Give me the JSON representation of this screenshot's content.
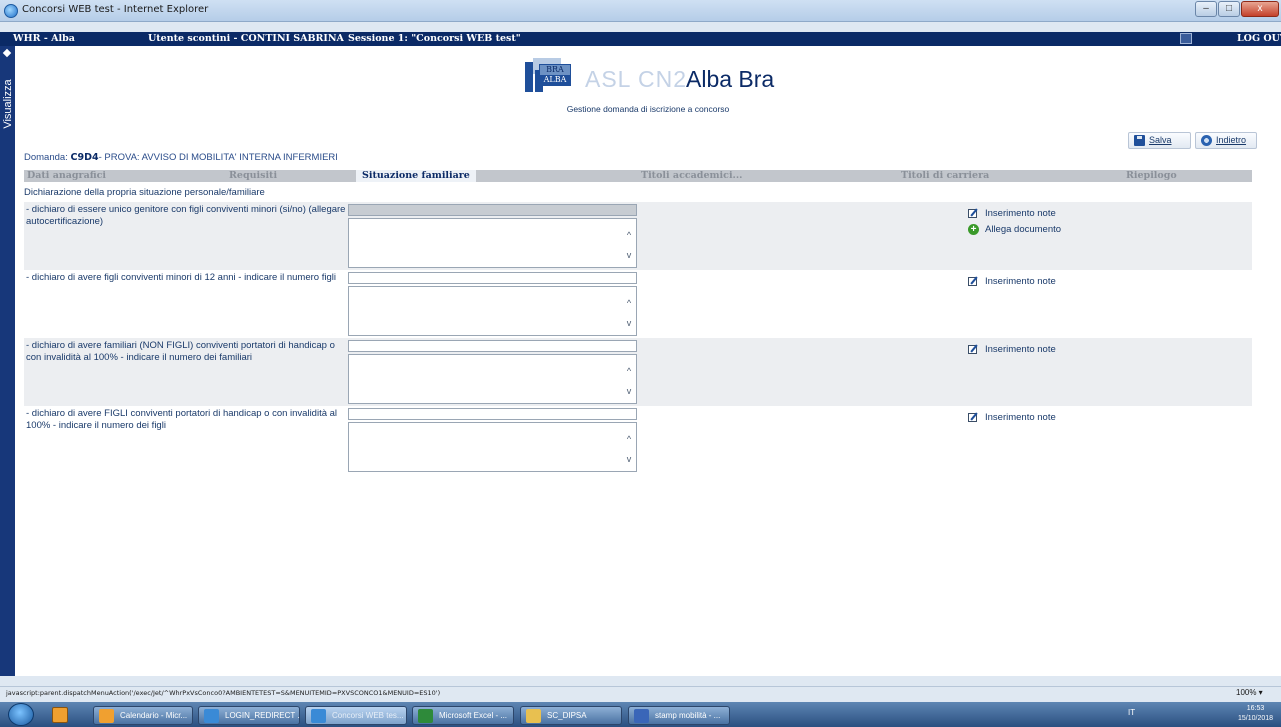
{
  "window": {
    "title": "Concorsi WEB test - Internet Explorer",
    "min": "–",
    "max": "□",
    "close": "x"
  },
  "appbar": {
    "app": "WHR - Alba",
    "user": "Utente scontini - CONTINI SABRINA",
    "session": "Sessione 1: \"Concorsi WEB test\"",
    "logout": "LOG OUT"
  },
  "sidebar": {
    "label": "Visualizza"
  },
  "header": {
    "logo_top": "BRA",
    "logo_bottom": "ALBA",
    "logo_asl": "ASL CN2",
    "logo_city": "Alba Bra",
    "subtitle": "Gestione domanda di iscrizione a concorso"
  },
  "toolbar": {
    "save_label": "Salva",
    "back_label": "Indietro"
  },
  "domanda": {
    "prefix": "Domanda:",
    "code": "C9D4",
    "title": "- PROVA: AVVISO DI MOBILITA' INTERNA INFERMIERI"
  },
  "tabs": [
    {
      "label": "Dati anagrafici"
    },
    {
      "label": "Requisiti"
    },
    {
      "label": "Situazione familiare"
    },
    {
      "label": "Titoli accademici..."
    },
    {
      "label": "Titoli di carriera"
    },
    {
      "label": "Riepilogo"
    }
  ],
  "section_title": "Dichiarazione della propria situazione personale/familiare",
  "questions": [
    {
      "text": "- dichiaro di essere unico genitore con figli conviventi minori (si/no) (allegare autocertificazione)",
      "value": "",
      "notes": "",
      "note_link": "Inserimento note",
      "attach_link": "Allega documento"
    },
    {
      "text": "- dichiaro di avere figli conviventi minori di 12 anni - indicare il numero figli",
      "value": "",
      "notes": "",
      "note_link": "Inserimento note"
    },
    {
      "text": "- dichiaro di avere familiari (NON FIGLI) conviventi portatori di handicap o con invalidità al 100% - indicare il numero dei familiari",
      "value": "",
      "notes": "",
      "note_link": "Inserimento note"
    },
    {
      "text": "- dichiaro di avere FIGLI conviventi portatori di handicap o con invalidità al 100% - indicare il numero dei figli",
      "value": "",
      "notes": "",
      "note_link": "Inserimento note"
    }
  ],
  "scroll": {
    "up": "^",
    "down": "v"
  },
  "statusbar": {
    "url": "javascript:parent.dispatchMenuAction('/exec/Jet/^WhrPxVsConco0?AMBIENTETEST=S&MENUITEMID=PXVSCONCO1&MENUID=ES10')",
    "zoom": "100% ▾"
  },
  "taskbar": {
    "items": [
      "Calendario - Micr...",
      "LOGIN_REDIRECT ...",
      "Concorsi WEB tes...",
      "Microsoft Excel - ...",
      "SC_DIPSA",
      "stamp mobilità - ..."
    ],
    "lang": "IT",
    "time": "16:53",
    "date": "15/10/2018"
  }
}
